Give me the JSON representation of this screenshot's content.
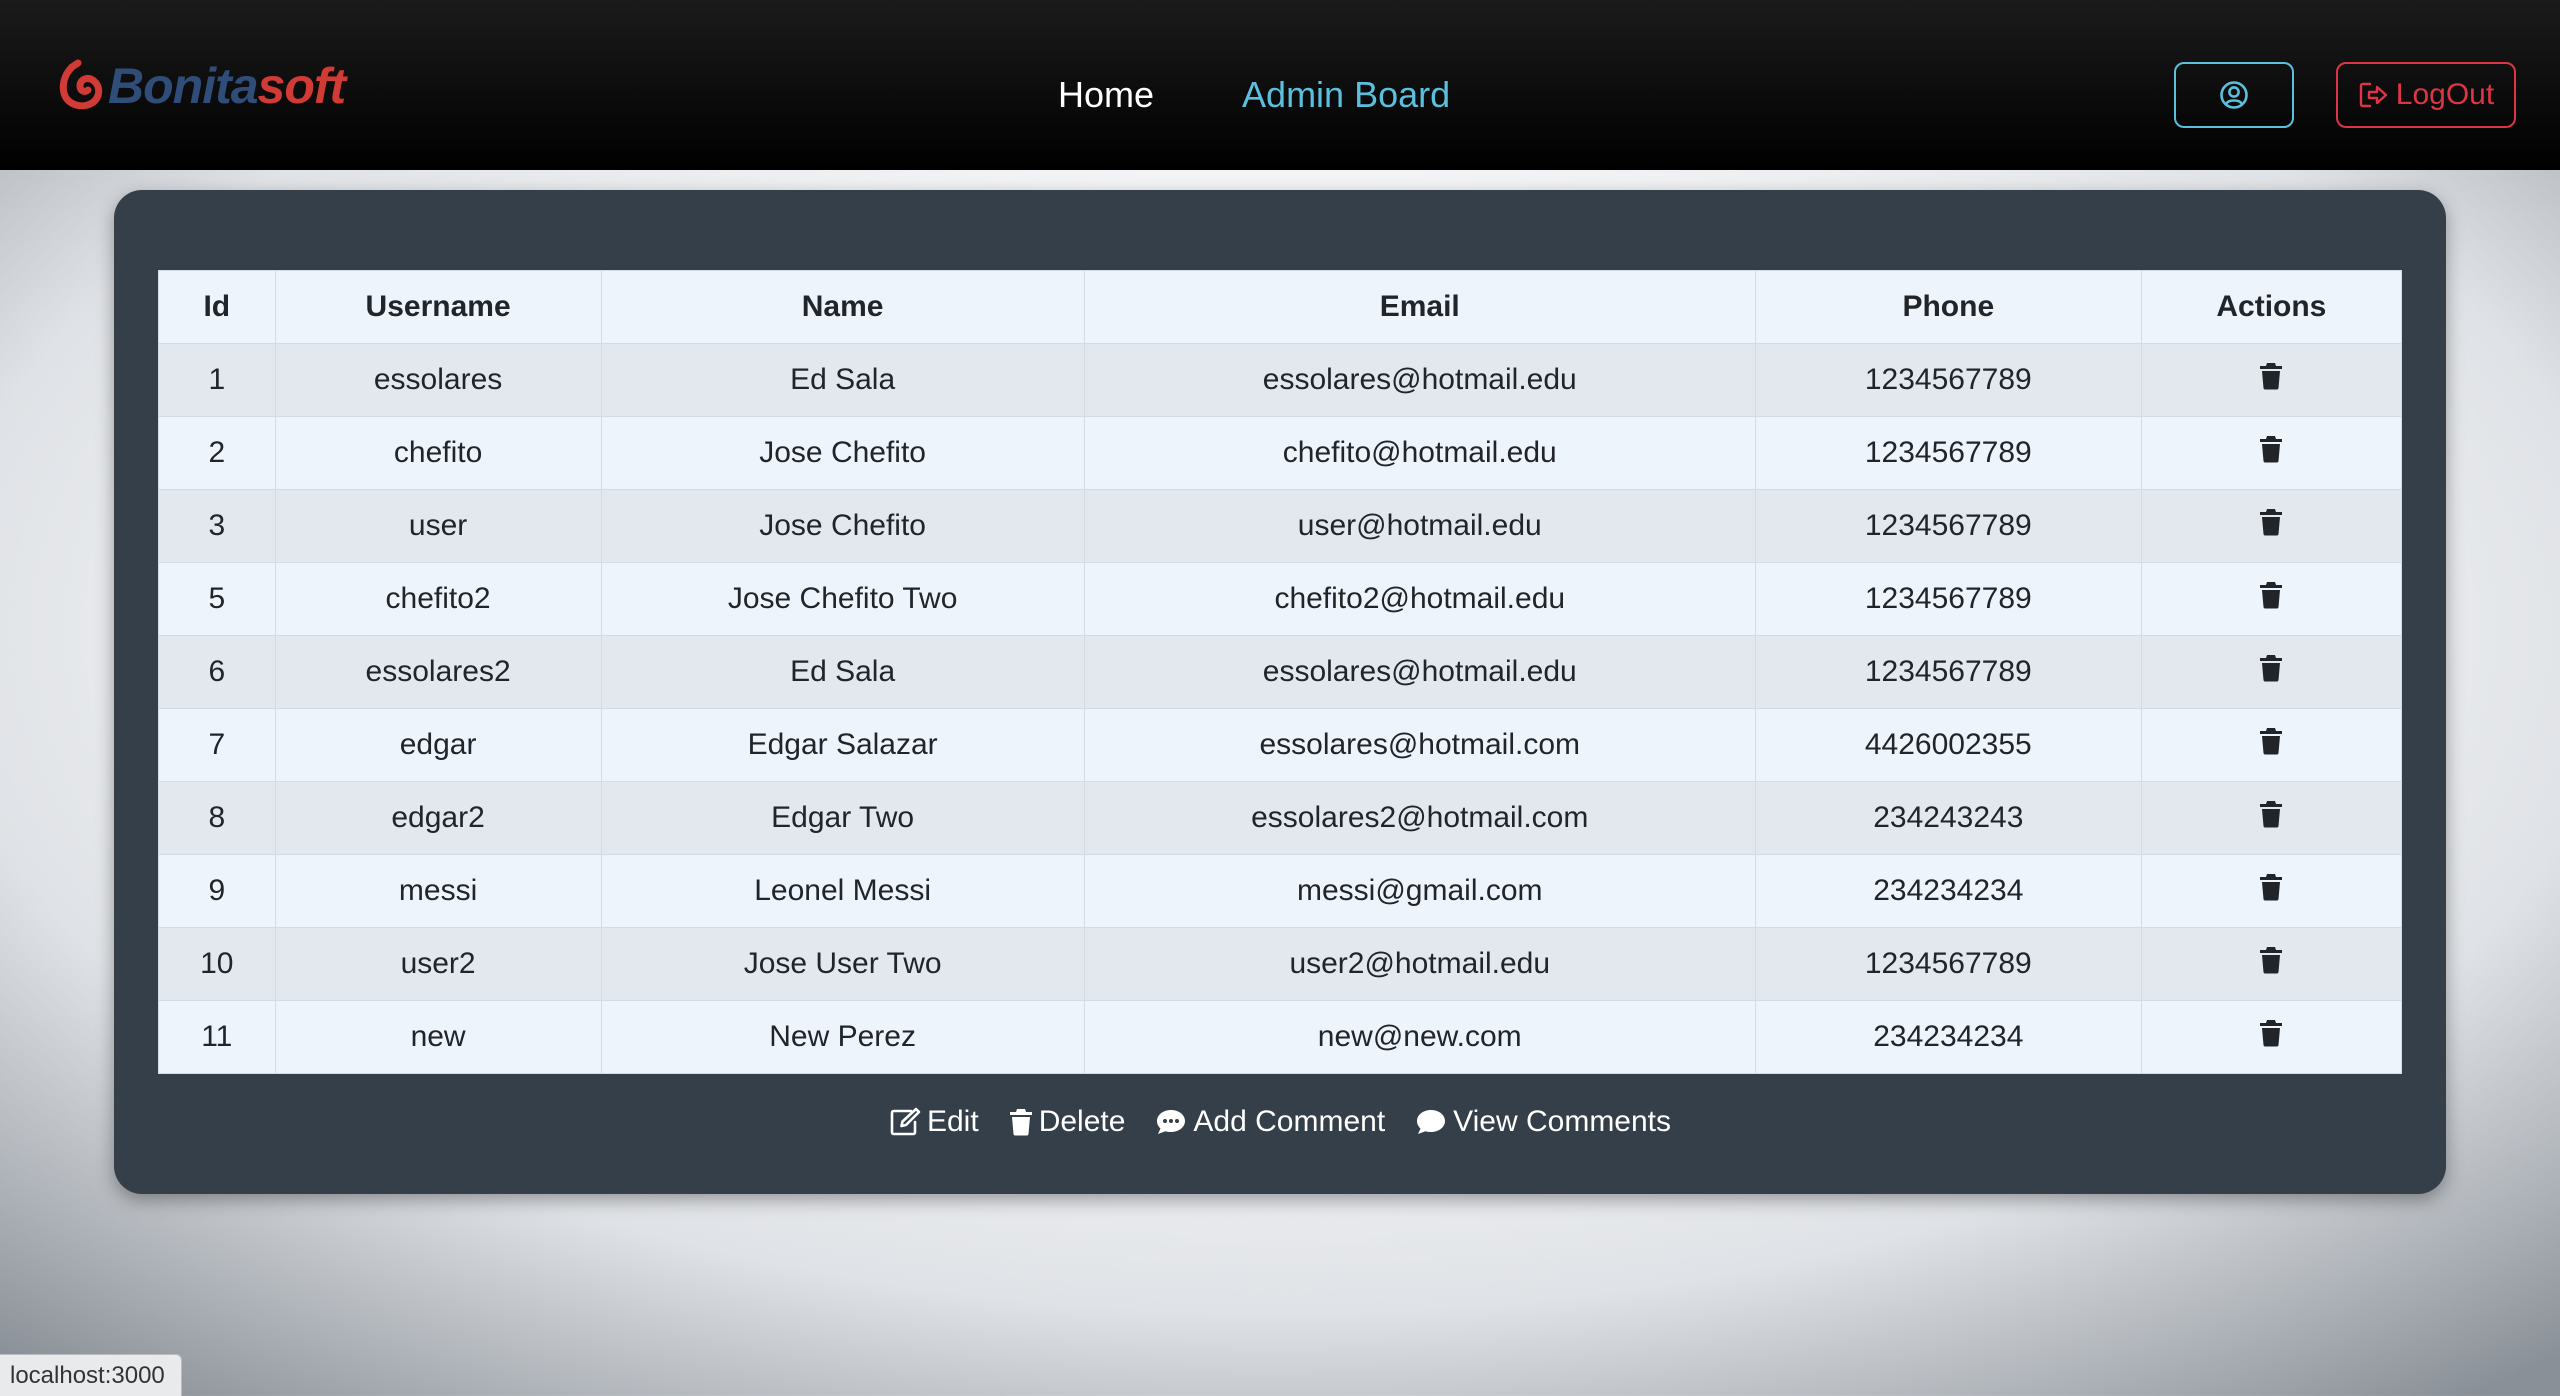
{
  "brand": {
    "name_part1": "Bonita",
    "name_part2": "soft"
  },
  "nav": {
    "home": "Home",
    "admin": "Admin Board",
    "logout": "LogOut"
  },
  "icons": {
    "profile": "user-circle-icon",
    "logout": "sign-out-icon",
    "trash": "trash-icon",
    "edit": "edit-icon",
    "comment_add": "comment-dots-icon",
    "comment_view": "comment-icon"
  },
  "colors": {
    "navbar": "#000000",
    "accent_info": "#5bc0de",
    "danger": "#dc3545",
    "card": "#343f49"
  },
  "table": {
    "headers": {
      "id": "Id",
      "username": "Username",
      "name": "Name",
      "email": "Email",
      "phone": "Phone",
      "actions": "Actions"
    },
    "rows": [
      {
        "id": "1",
        "username": "essolares",
        "name": "Ed Sala",
        "email": "essolares@hotmail.edu",
        "phone": "1234567789"
      },
      {
        "id": "2",
        "username": "chefito",
        "name": "Jose Chefito",
        "email": "chefito@hotmail.edu",
        "phone": "1234567789"
      },
      {
        "id": "3",
        "username": "user",
        "name": "Jose Chefito",
        "email": "user@hotmail.edu",
        "phone": "1234567789"
      },
      {
        "id": "5",
        "username": "chefito2",
        "name": "Jose Chefito Two",
        "email": "chefito2@hotmail.edu",
        "phone": "1234567789"
      },
      {
        "id": "6",
        "username": "essolares2",
        "name": "Ed Sala",
        "email": "essolares@hotmail.edu",
        "phone": "1234567789"
      },
      {
        "id": "7",
        "username": "edgar",
        "name": "Edgar Salazar",
        "email": "essolares@hotmail.com",
        "phone": "4426002355"
      },
      {
        "id": "8",
        "username": "edgar2",
        "name": "Edgar Two",
        "email": "essolares2@hotmail.com",
        "phone": "234243243"
      },
      {
        "id": "9",
        "username": "messi",
        "name": "Leonel Messi",
        "email": "messi@gmail.com",
        "phone": "234234234"
      },
      {
        "id": "10",
        "username": "user2",
        "name": "Jose User Two",
        "email": "user2@hotmail.edu",
        "phone": "1234567789"
      },
      {
        "id": "11",
        "username": "new",
        "name": "New Perez",
        "email": "new@new.com",
        "phone": "234234234"
      }
    ]
  },
  "legend": {
    "edit": "Edit",
    "delete": "Delete",
    "add_comment": "Add Comment",
    "view_comments": "View Comments"
  },
  "status_bar": {
    "url": "localhost:3000"
  }
}
